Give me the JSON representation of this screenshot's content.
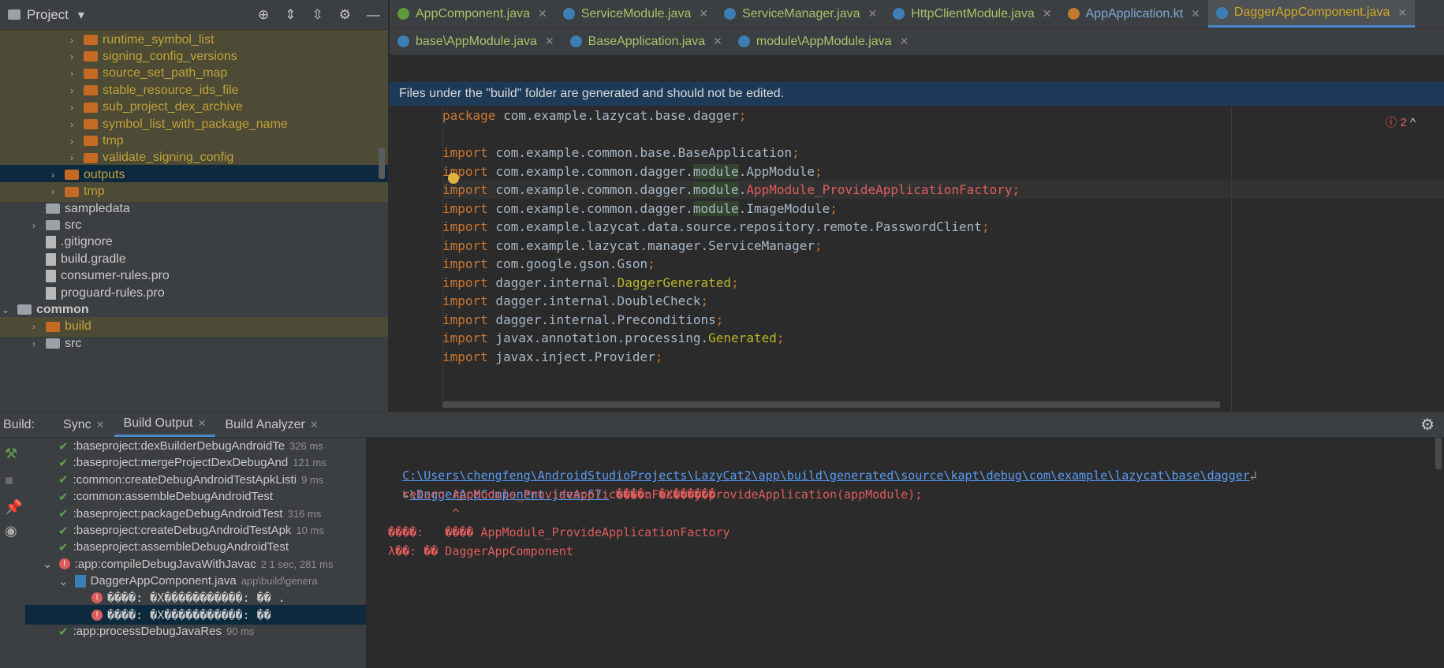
{
  "project": {
    "title": "Project",
    "tree": [
      {
        "label": "runtime_symbol_list",
        "depth": 4,
        "kind": "folder",
        "color": "orange",
        "text": "yellow",
        "arrow": "›",
        "hl": "yellow"
      },
      {
        "label": "signing_config_versions",
        "depth": 4,
        "kind": "folder",
        "color": "orange",
        "text": "yellow",
        "arrow": "›",
        "hl": "yellow"
      },
      {
        "label": "source_set_path_map",
        "depth": 4,
        "kind": "folder",
        "color": "orange",
        "text": "yellow",
        "arrow": "›",
        "hl": "yellow"
      },
      {
        "label": "stable_resource_ids_file",
        "depth": 4,
        "kind": "folder",
        "color": "orange",
        "text": "yellow",
        "arrow": "›",
        "hl": "yellow"
      },
      {
        "label": "sub_project_dex_archive",
        "depth": 4,
        "kind": "folder",
        "color": "orange",
        "text": "yellow",
        "arrow": "›",
        "hl": "yellow"
      },
      {
        "label": "symbol_list_with_package_name",
        "depth": 4,
        "kind": "folder",
        "color": "orange",
        "text": "yellow",
        "arrow": "›",
        "hl": "yellow"
      },
      {
        "label": "tmp",
        "depth": 4,
        "kind": "folder",
        "color": "orange",
        "text": "yellow",
        "arrow": "›",
        "hl": "yellow"
      },
      {
        "label": "validate_signing_config",
        "depth": 4,
        "kind": "folder",
        "color": "orange",
        "text": "yellow",
        "arrow": "›",
        "hl": "yellow"
      },
      {
        "label": "outputs",
        "depth": 3,
        "kind": "folder",
        "color": "orange",
        "text": "yellow",
        "arrow": "›",
        "hl": "sel"
      },
      {
        "label": "tmp",
        "depth": 3,
        "kind": "folder",
        "color": "orange",
        "text": "yellow",
        "arrow": "›",
        "hl": "yellow"
      },
      {
        "label": "sampledata",
        "depth": 2,
        "kind": "folder",
        "color": "gray",
        "text": "white",
        "arrow": "",
        "hl": ""
      },
      {
        "label": "src",
        "depth": 2,
        "kind": "folder",
        "color": "gray",
        "text": "white",
        "arrow": "›",
        "hl": ""
      },
      {
        "label": ".gitignore",
        "depth": 2,
        "kind": "file",
        "color": "gray",
        "text": "white",
        "arrow": "",
        "hl": ""
      },
      {
        "label": "build.gradle",
        "depth": 2,
        "kind": "file",
        "color": "gray",
        "text": "white",
        "arrow": "",
        "hl": ""
      },
      {
        "label": "consumer-rules.pro",
        "depth": 2,
        "kind": "file",
        "color": "gray",
        "text": "white",
        "arrow": "",
        "hl": ""
      },
      {
        "label": "proguard-rules.pro",
        "depth": 2,
        "kind": "file",
        "color": "gray",
        "text": "white",
        "arrow": "",
        "hl": ""
      },
      {
        "label": "common",
        "depth": 1,
        "kind": "folder",
        "color": "gray",
        "text": "white",
        "arrow": "⌄",
        "hl": ""
      },
      {
        "label": "build",
        "depth": 2,
        "kind": "folder",
        "color": "orange",
        "text": "yellow",
        "arrow": "›",
        "hl": "yellow"
      },
      {
        "label": "src",
        "depth": 2,
        "kind": "folder",
        "color": "gray",
        "text": "white",
        "arrow": "›",
        "hl": ""
      }
    ]
  },
  "editor": {
    "tabs_row1": [
      {
        "name": "AppComponent.java",
        "icon": "green",
        "active": false,
        "blue": false
      },
      {
        "name": "ServiceModule.java",
        "icon": "blue",
        "active": false,
        "blue": false
      },
      {
        "name": "ServiceManager.java",
        "icon": "blue",
        "active": false,
        "blue": false
      },
      {
        "name": "HttpClientModule.java",
        "icon": "blue",
        "active": false,
        "blue": false
      },
      {
        "name": "AppApplication.kt",
        "icon": "orange",
        "active": false,
        "blue": true
      },
      {
        "name": "DaggerAppComponent.java",
        "icon": "blue",
        "active": true,
        "blue": false
      }
    ],
    "tabs_row2": [
      {
        "name": "base\\AppModule.java",
        "icon": "blue"
      },
      {
        "name": "BaseApplication.java",
        "icon": "blue"
      },
      {
        "name": "module\\AppModule.java",
        "icon": "blue"
      }
    ],
    "banner": "Files under the \"build\" folder are generated and should not be edited.",
    "error_count": "2",
    "lines": [
      {
        "kw": "package",
        "body": " com.example.lazycat.base.dagger",
        "tail": ";"
      },
      {
        "kw": "",
        "body": "",
        "tail": ""
      },
      {
        "kw": "import",
        "body": " com.example.common.base.BaseApplication",
        "tail": ";"
      },
      {
        "kw": "import",
        "body": " com.example.common.dagger.",
        "mod": "module",
        "rest": ".AppModule",
        "tail": ";"
      },
      {
        "kw": "import",
        "body": " com.example.common.dagger.",
        "mod": "module",
        "rest": ".",
        "err": "AppModule_ProvideApplicationFactory",
        "tail": ";"
      },
      {
        "kw": "import",
        "body": " com.example.common.dagger.",
        "mod": "module",
        "rest": ".ImageModule",
        "tail": ";"
      },
      {
        "kw": "import",
        "body": " com.example.lazycat.data.source.repository.remote.PasswordClient",
        "tail": ";"
      },
      {
        "kw": "import",
        "body": " com.example.lazycat.manager.ServiceManager",
        "tail": ";"
      },
      {
        "kw": "import",
        "body": " com.google.gson.Gson",
        "tail": ";"
      },
      {
        "kw": "import",
        "body": " dagger.internal.",
        "ann": "DaggerGenerated",
        "tail": ";"
      },
      {
        "kw": "import",
        "body": " dagger.internal.DoubleCheck",
        "tail": ";"
      },
      {
        "kw": "import",
        "body": " dagger.internal.Preconditions",
        "tail": ";"
      },
      {
        "kw": "import",
        "body": " javax.annotation.processing.",
        "ann": "Generated",
        "tail": ";"
      },
      {
        "kw": "import",
        "body": " javax.inject.Provider",
        "tail": ";"
      }
    ]
  },
  "build": {
    "label": "Build:",
    "tabs": [
      {
        "name": "Sync",
        "close": true,
        "active": false
      },
      {
        "name": "Build Output",
        "close": true,
        "active": true
      },
      {
        "name": "Build Analyzer",
        "close": true,
        "active": false
      }
    ],
    "tree": [
      {
        "label": ":baseproject:dexBuilderDebugAndroidTe",
        "time": "326 ms",
        "status": "ok",
        "depth": 1
      },
      {
        "label": ":baseproject:mergeProjectDexDebugAnd",
        "time": "121 ms",
        "status": "ok",
        "depth": 1
      },
      {
        "label": ":common:createDebugAndroidTestApkListi",
        "time": "9 ms",
        "status": "ok",
        "depth": 1
      },
      {
        "label": ":common:assembleDebugAndroidTest",
        "time": "",
        "status": "ok",
        "depth": 1
      },
      {
        "label": ":baseproject:packageDebugAndroidTest",
        "time": "316 ms",
        "status": "ok",
        "depth": 1
      },
      {
        "label": ":baseproject:createDebugAndroidTestApk",
        "time": "10 ms",
        "status": "ok",
        "depth": 1
      },
      {
        "label": ":baseproject:assembleDebugAndroidTest",
        "time": "",
        "status": "ok",
        "depth": 1
      },
      {
        "label": ":app:compileDebugJavaWithJavac",
        "time": "2 1 sec, 281 ms",
        "status": "err",
        "depth": 0
      },
      {
        "label": "DaggerAppComponent.java",
        "time": "app\\build\\genera",
        "status": "file",
        "depth": 1
      },
      {
        "label": "����: �X�����������:  �� .",
        "time": "",
        "status": "err",
        "depth": 2
      },
      {
        "label": "����: �X�����������:  ��",
        "time": "",
        "status": "err-sel",
        "depth": 2
      },
      {
        "label": ":app:processDebugJavaRes",
        "time": "90 ms",
        "status": "ok",
        "depth": 1
      }
    ],
    "output": {
      "path1": "C:\\Users\\chengfeng\\AndroidStudioProjects\\LazyCat2\\app\\build\\generated\\source\\kapt\\debug\\com\\example\\lazycat\\base\\dagger",
      "wrap1": "↲",
      "wrap2": "↳",
      "path2": "\\DaggerAppComponent.java:67:",
      "err1": " ����: �X������",
      "line3": "    return AppModule_ProvideApplicationFactory.provideApplication(appModule);",
      "line4": "           ^",
      "line5": "  ����:   ���� AppModule_ProvideApplicationFactory",
      "line6": "  λ��: �� DaggerAppComponent"
    }
  }
}
